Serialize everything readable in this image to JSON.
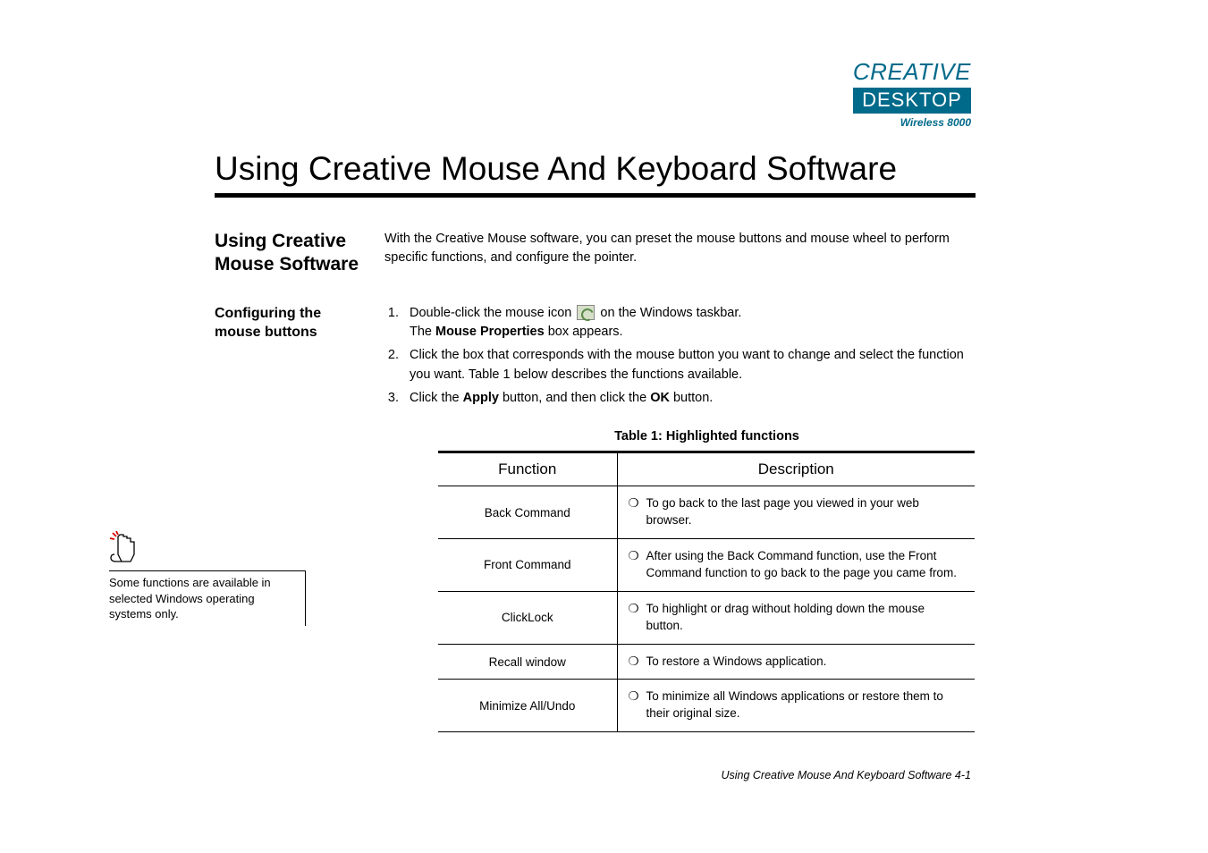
{
  "logo": {
    "line1": "CREATIVE",
    "line2": "DESKTOP",
    "sub": "Wireless 8000"
  },
  "main_title": "Using Creative Mouse And Keyboard Software",
  "section1": {
    "head": "Using Creative Mouse Software",
    "body": "With the Creative Mouse software, you can preset the mouse buttons and mouse wheel to perform specific functions, and configure the pointer."
  },
  "section2": {
    "head": "Configuring the mouse buttons",
    "steps": {
      "s1_a": "Double-click the mouse icon ",
      "s1_b": " on the Windows taskbar.",
      "s1_c_pre": "The ",
      "s1_c_bold": "Mouse Properties",
      "s1_c_post": " box appears.",
      "s2": "Click the box that corresponds with the mouse button you want to change and select the function you want. Table 1 below describes the functions available.",
      "s3_a": "Click the ",
      "s3_b": "Apply",
      "s3_c": " button, and then click the ",
      "s3_d": "OK",
      "s3_e": " button."
    }
  },
  "table": {
    "title": "Table 1: Highlighted functions",
    "headers": {
      "col1": "Function",
      "col2": "Description"
    },
    "rows": [
      {
        "fn": "Back Command",
        "desc": "To go back to the last page you viewed in your web browser."
      },
      {
        "fn": "Front Command",
        "desc": "After using the Back Command function, use the Front Command function to go back to the page you came from."
      },
      {
        "fn": "ClickLock",
        "desc": "To highlight or drag without holding down the mouse button."
      },
      {
        "fn": "Recall window",
        "desc": "To restore a Windows application."
      },
      {
        "fn": "Minimize All/Undo",
        "desc": "To minimize all Windows applications or restore them to their original size."
      }
    ]
  },
  "note": "Some functions are available in selected Windows operating systems only.",
  "footer": "Using Creative Mouse And Keyboard Software 4-1",
  "bullet_char": "❍",
  "chart_data": {
    "type": "table",
    "title": "Table 1: Highlighted functions",
    "columns": [
      "Function",
      "Description"
    ],
    "rows": [
      [
        "Back Command",
        "To go back to the last page you viewed in your web browser."
      ],
      [
        "Front Command",
        "After using the Back Command function, use the Front Command function to go back to the page you came from."
      ],
      [
        "ClickLock",
        "To highlight or drag without holding down the mouse button."
      ],
      [
        "Recall window",
        "To restore a Windows application."
      ],
      [
        "Minimize All/Undo",
        "To minimize all Windows applications or restore them to their original size."
      ]
    ]
  }
}
